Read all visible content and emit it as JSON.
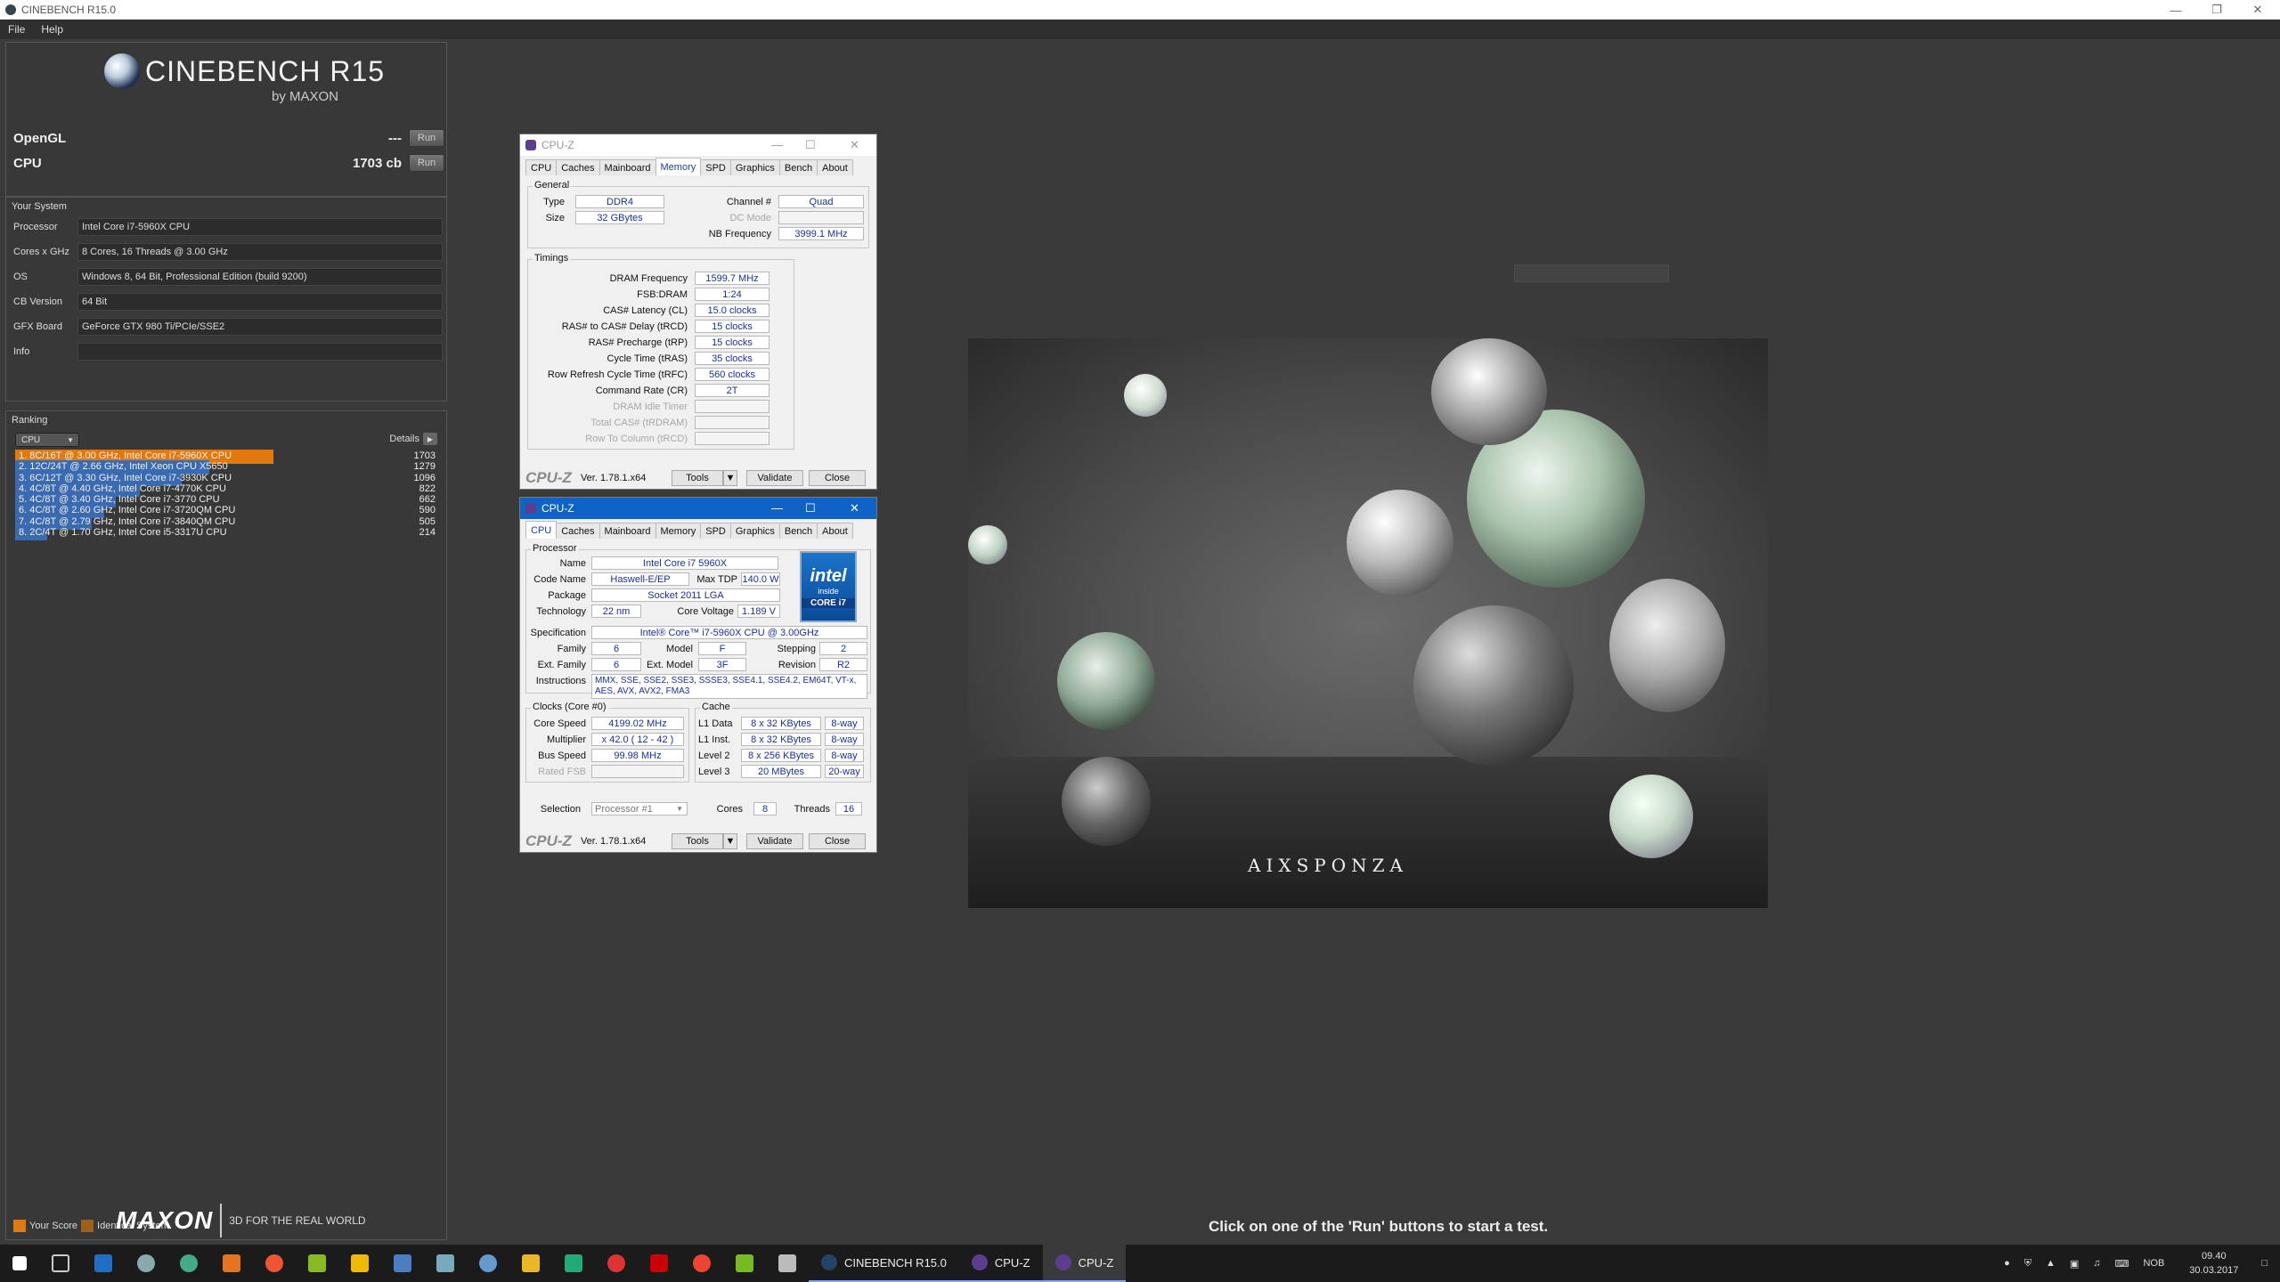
{
  "window": {
    "title": "CINEBENCH R15.0",
    "menu": [
      "File",
      "Help"
    ]
  },
  "logo": {
    "name": "CINEBENCH R15",
    "sub": "by MAXON"
  },
  "tests": [
    {
      "name": "OpenGL",
      "score": "---",
      "button": "Run"
    },
    {
      "name": "CPU",
      "score": "1703 cb",
      "button": "Run"
    }
  ],
  "system": {
    "legend": "Your System",
    "rows": [
      {
        "label": "Processor",
        "value": "Intel Core i7-5960X CPU"
      },
      {
        "label": "Cores x GHz",
        "value": "8 Cores, 16 Threads @ 3.00 GHz"
      },
      {
        "label": "OS",
        "value": "Windows 8, 64 Bit, Professional Edition (build 9200)"
      },
      {
        "label": "CB Version",
        "value": "64 Bit"
      },
      {
        "label": "GFX Board",
        "value": "GeForce GTX 980 Ti/PCIe/SSE2"
      },
      {
        "label": "Info",
        "value": ""
      }
    ]
  },
  "ranking": {
    "legend": "Ranking",
    "select": "CPU",
    "details": "Details",
    "max": 1703,
    "rows": [
      {
        "label": "1. 8C/16T @ 3.00 GHz, Intel Core i7-5960X CPU",
        "score": 1703,
        "color": "#e07a10"
      },
      {
        "label": "2. 12C/24T @ 2.66 GHz, Intel Xeon CPU X5650",
        "score": 1279,
        "color": "#3a6bb0"
      },
      {
        "label": "3. 6C/12T @ 3.30 GHz,  Intel Core i7-3930K CPU",
        "score": 1096,
        "color": "#3a6bb0"
      },
      {
        "label": "4. 4C/8T @ 4.40 GHz, Intel Core i7-4770K CPU",
        "score": 822,
        "color": "#3a6bb0"
      },
      {
        "label": "5. 4C/8T @ 3.40 GHz,  Intel Core i7-3770 CPU",
        "score": 662,
        "color": "#3a6bb0"
      },
      {
        "label": "6. 4C/8T @ 2.60 GHz, Intel Core i7-3720QM CPU",
        "score": 590,
        "color": "#3a6bb0"
      },
      {
        "label": "7. 4C/8T @ 2.79 GHz,  Intel Core i7-3840QM CPU",
        "score": 505,
        "color": "#3a6bb0"
      },
      {
        "label": "8. 2C/4T @ 1.70 GHz,  Intel Core i5-3317U CPU",
        "score": 214,
        "color": "#3a6bb0"
      }
    ],
    "legend_items": [
      {
        "label": "Your Score",
        "color": "#e07a10"
      },
      {
        "label": "Identical System",
        "color": "#a0601a"
      }
    ]
  },
  "maxon": {
    "brand": "MAXON",
    "tagline": "3D FOR THE REAL WORLD"
  },
  "render": {
    "watermark": "AIXSPONZA",
    "status": "Click on one of the 'Run' buttons to start a test."
  },
  "cpuz_memory": {
    "title": "CPU-Z",
    "tabs": [
      "CPU",
      "Caches",
      "Mainboard",
      "Memory",
      "SPD",
      "Graphics",
      "Bench",
      "About"
    ],
    "selected_tab": "Memory",
    "general_legend": "General",
    "type_label": "Type",
    "type": "DDR4",
    "size_label": "Size",
    "size": "32 GBytes",
    "channel_label": "Channel #",
    "channel": "Quad",
    "dc_label": "DC Mode",
    "dc": "",
    "nb_label": "NB Frequency",
    "nb": "3999.1 MHz",
    "timings_legend": "Timings",
    "timings": [
      {
        "label": "DRAM Frequency",
        "value": "1599.7 MHz",
        "dim": false
      },
      {
        "label": "FSB:DRAM",
        "value": "1:24",
        "dim": false
      },
      {
        "label": "CAS# Latency (CL)",
        "value": "15.0 clocks",
        "dim": false
      },
      {
        "label": "RAS# to CAS# Delay (tRCD)",
        "value": "15 clocks",
        "dim": false
      },
      {
        "label": "RAS# Precharge (tRP)",
        "value": "15 clocks",
        "dim": false
      },
      {
        "label": "Cycle Time (tRAS)",
        "value": "35 clocks",
        "dim": false
      },
      {
        "label": "Row Refresh Cycle Time (tRFC)",
        "value": "560 clocks",
        "dim": false
      },
      {
        "label": "Command Rate (CR)",
        "value": "2T",
        "dim": false
      },
      {
        "label": "DRAM Idle Timer",
        "value": "",
        "dim": true
      },
      {
        "label": "Total CAS# (tRDRAM)",
        "value": "",
        "dim": true
      },
      {
        "label": "Row To Column (tRCD)",
        "value": "",
        "dim": true
      }
    ],
    "brand": "CPU-Z",
    "version": "Ver. 1.78.1.x64",
    "tools": "Tools",
    "validate": "Validate",
    "close": "Close"
  },
  "cpuz_cpu": {
    "title": "CPU-Z",
    "tabs": [
      "CPU",
      "Caches",
      "Mainboard",
      "Memory",
      "SPD",
      "Graphics",
      "Bench",
      "About"
    ],
    "selected_tab": "CPU",
    "processor_legend": "Processor",
    "name_label": "Name",
    "name": "Intel Core i7 5960X",
    "codename_label": "Code Name",
    "codename": "Haswell-E/EP",
    "tdp_label": "Max TDP",
    "tdp": "140.0 W",
    "package_label": "Package",
    "package": "Socket 2011 LGA",
    "tech_label": "Technology",
    "tech": "22 nm",
    "voltage_label": "Core Voltage",
    "voltage": "1.189 V",
    "spec_label": "Specification",
    "spec": "Intel® Core™ i7-5960X CPU @ 3.00GHz",
    "family_label": "Family",
    "family": "6",
    "model_label": "Model",
    "model": "F",
    "stepping_label": "Stepping",
    "stepping": "2",
    "extfamily_label": "Ext. Family",
    "extfamily": "6",
    "extmodel_label": "Ext. Model",
    "extmodel": "3F",
    "revision_label": "Revision",
    "revision": "R2",
    "instr_label": "Instructions",
    "instr": "MMX, SSE, SSE2, SSE3, SSSE3, SSE4.1, SSE4.2, EM64T, VT-x, AES, AVX, AVX2, FMA3",
    "intel": {
      "t1": "intel",
      "t2": "inside",
      "t3": "CORE i7"
    },
    "clocks_legend": "Clocks (Core #0)",
    "corespeed_label": "Core Speed",
    "corespeed": "4199.02 MHz",
    "multiplier_label": "Multiplier",
    "multiplier": "x 42.0 ( 12 - 42 )",
    "busspeed_label": "Bus Speed",
    "busspeed": "99.98 MHz",
    "ratedfsb_label": "Rated FSB",
    "ratedfsb": "",
    "cache_legend": "Cache",
    "cache": [
      {
        "label": "L1 Data",
        "size": "8 x 32 KBytes",
        "way": "8-way"
      },
      {
        "label": "L1 Inst.",
        "size": "8 x 32 KBytes",
        "way": "8-way"
      },
      {
        "label": "Level 2",
        "size": "8 x 256 KBytes",
        "way": "8-way"
      },
      {
        "label": "Level 3",
        "size": "20 MBytes",
        "way": "20-way"
      }
    ],
    "selection_label": "Selection",
    "selection": "Processor #1",
    "cores_label": "Cores",
    "cores": "8",
    "threads_label": "Threads",
    "threads": "16",
    "brand": "CPU-Z",
    "version": "Ver. 1.78.1.x64",
    "tools": "Tools",
    "validate": "Validate",
    "close": "Close"
  },
  "taskbar": {
    "apps": [
      "CINEBENCH R15.0",
      "CPU-Z",
      "CPU-Z"
    ],
    "lang": "NOB",
    "time": "09.40",
    "date": "30.03.2017"
  }
}
